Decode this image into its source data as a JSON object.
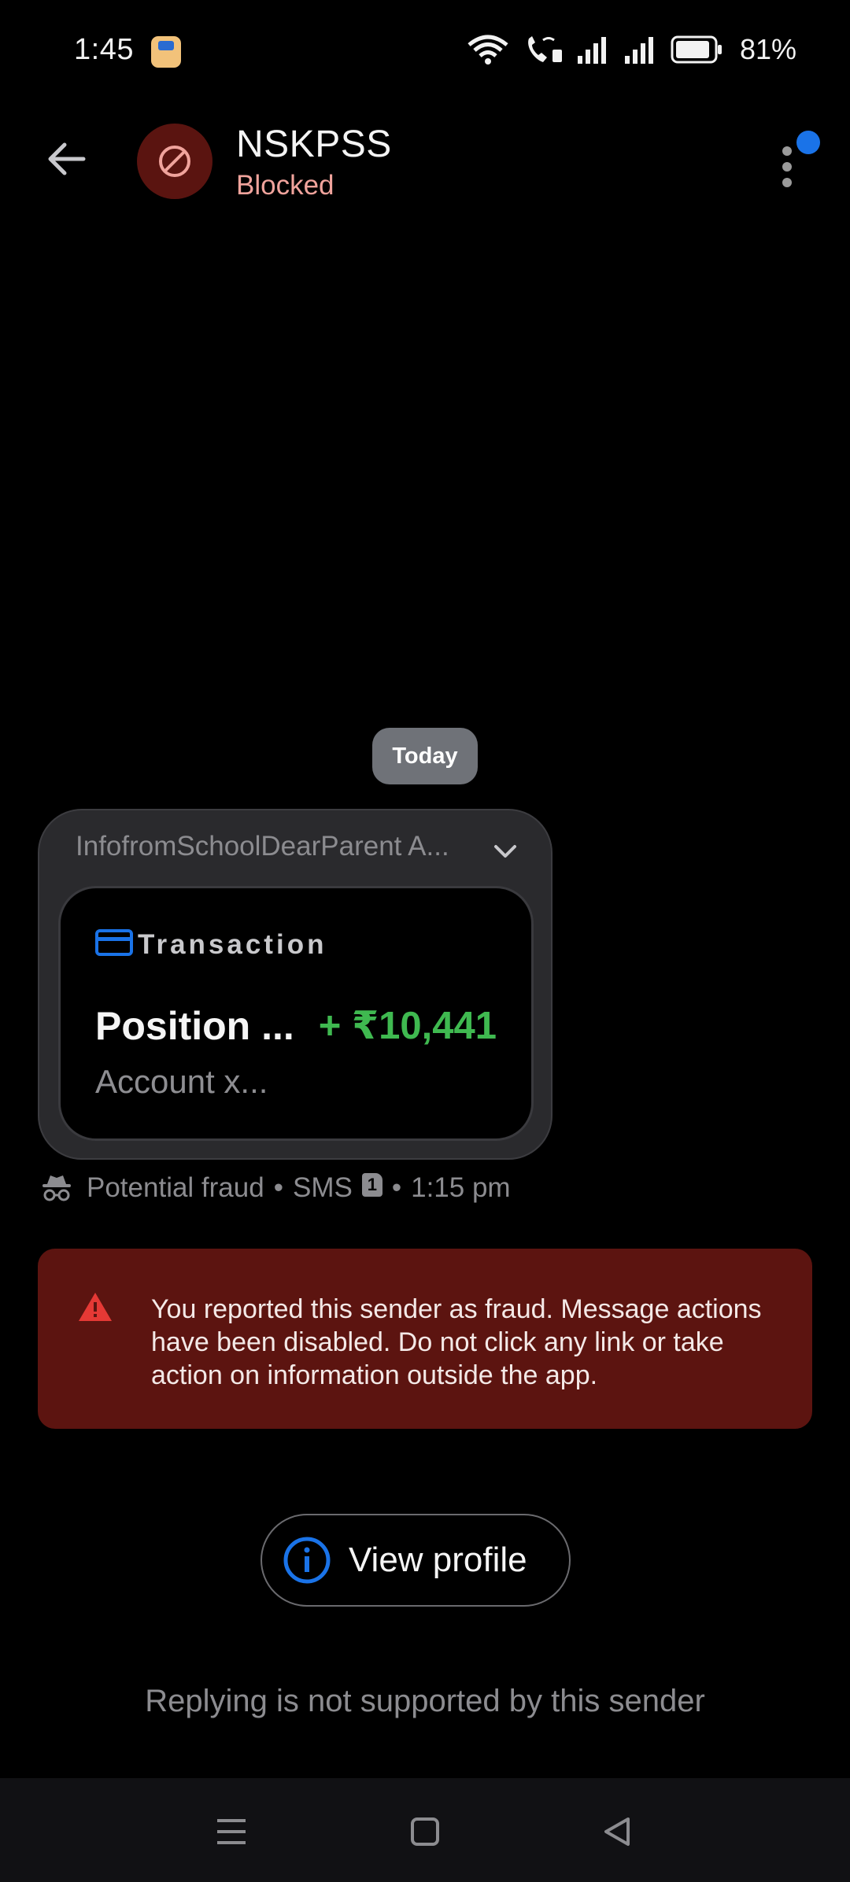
{
  "status_bar": {
    "time": "1:45",
    "battery": "81%",
    "icons": [
      "notification-app-icon",
      "wifi-icon",
      "wifi-calling-icon",
      "signal-icon",
      "signal-icon",
      "battery-icon"
    ]
  },
  "header": {
    "contact_name": "NSKPSS",
    "contact_status": "Blocked",
    "avatar_icon": "blocked-icon",
    "colors": {
      "avatar_bg": "#5a1410",
      "status_text": "#f0a39c",
      "badge": "#1a73e8"
    }
  },
  "conversation": {
    "date_chip": "Today",
    "message": {
      "preview": "InfofromSchoolDearParent A...",
      "card": {
        "icon": "credit-card-icon",
        "title": "Transaction",
        "main_text": "Position ...",
        "amount": "+ ₹10,441",
        "sub_text": "Account x..."
      },
      "colors": {
        "amount": "#3fb950",
        "card_icon": "#1a73e8"
      }
    },
    "meta": {
      "label": "Potential fraud",
      "channel": "SMS",
      "sim": "1",
      "time": "1:15 pm",
      "separator": "•"
    }
  },
  "warning": {
    "icon": "warning-triangle-icon",
    "text": "You reported this sender as fraud. Message actions have been disabled. Do not click any link or take action on information outside the app.",
    "colors": {
      "background": "#5c1410",
      "icon": "#e53935"
    }
  },
  "actions": {
    "view_profile_label": "View profile",
    "view_profile_icon": "info-icon"
  },
  "footer": {
    "reply_note": "Replying is not supported by this sender"
  },
  "navbar": {
    "items": [
      "menu-icon",
      "home-icon",
      "back-triangle-icon"
    ]
  }
}
